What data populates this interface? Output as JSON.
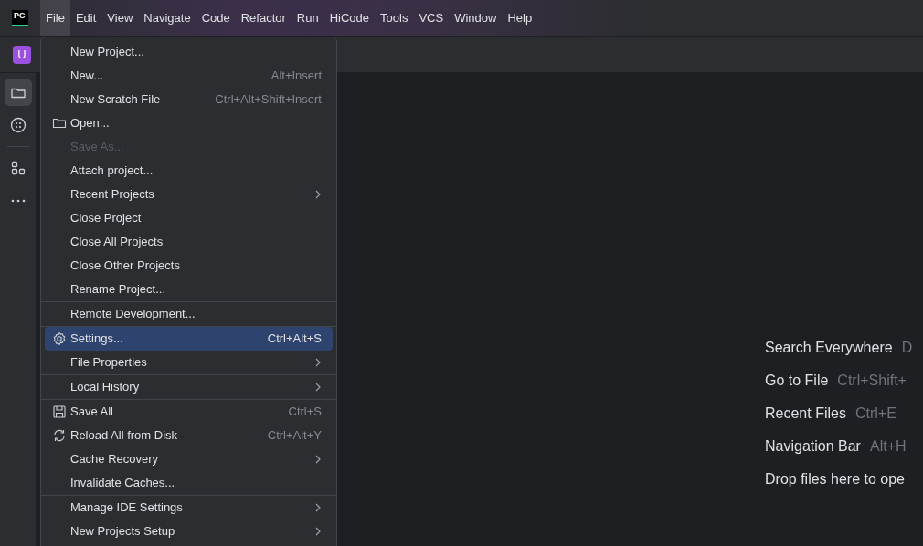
{
  "app_logo": "PC",
  "menu_bar": [
    {
      "label": "File",
      "selected": true
    },
    {
      "label": "Edit",
      "selected": false
    },
    {
      "label": "View",
      "selected": false
    },
    {
      "label": "Navigate",
      "selected": false
    },
    {
      "label": "Code",
      "selected": false
    },
    {
      "label": "Refactor",
      "selected": false
    },
    {
      "label": "Run",
      "selected": false
    },
    {
      "label": "HiCode",
      "selected": false
    },
    {
      "label": "Tools",
      "selected": false
    },
    {
      "label": "VCS",
      "selected": false
    },
    {
      "label": "Window",
      "selected": false
    },
    {
      "label": "Help",
      "selected": false
    }
  ],
  "project_badge": "U",
  "tool_strip": [
    {
      "kind": "folder",
      "selected": true
    },
    {
      "kind": "plugin",
      "selected": false
    },
    {
      "kind": "separator"
    },
    {
      "kind": "structure",
      "selected": false
    },
    {
      "kind": "more",
      "selected": false
    }
  ],
  "file_menu": {
    "groups": [
      [
        {
          "label": "New Project..."
        },
        {
          "label": "New...",
          "shortcut": "Alt+Insert"
        },
        {
          "label": "New Scratch File",
          "shortcut": "Ctrl+Alt+Shift+Insert"
        },
        {
          "label": "Open...",
          "kind": "folder"
        },
        {
          "label": "Save As...",
          "disabled": true
        },
        {
          "label": "Attach project..."
        },
        {
          "label": "Recent Projects",
          "submenu": true
        },
        {
          "label": "Close Project"
        },
        {
          "label": "Close All Projects"
        },
        {
          "label": "Close Other Projects"
        },
        {
          "label": "Rename Project..."
        }
      ],
      [
        {
          "label": "Remote Development..."
        }
      ],
      [
        {
          "label": "Settings...",
          "shortcut": "Ctrl+Alt+S",
          "kind": "gear",
          "selected": true
        },
        {
          "label": "File Properties",
          "submenu": true
        }
      ],
      [
        {
          "label": "Local History",
          "submenu": true
        }
      ],
      [
        {
          "label": "Save All",
          "shortcut": "Ctrl+S",
          "kind": "save"
        },
        {
          "label": "Reload All from Disk",
          "shortcut": "Ctrl+Alt+Y",
          "kind": "reload"
        },
        {
          "label": "Cache Recovery",
          "submenu": true
        },
        {
          "label": "Invalidate Caches..."
        }
      ],
      [
        {
          "label": "Manage IDE Settings",
          "submenu": true
        },
        {
          "label": "New Projects Setup",
          "submenu": true
        }
      ]
    ]
  },
  "welcome_hints": [
    {
      "action": "Search Everywhere",
      "shortcut": "D"
    },
    {
      "action": "Go to File",
      "shortcut": "Ctrl+Shift+"
    },
    {
      "action": "Recent Files",
      "shortcut": "Ctrl+E"
    },
    {
      "action": "Navigation Bar",
      "shortcut": "Alt+H"
    },
    {
      "action": "Drop files here to ope"
    }
  ]
}
